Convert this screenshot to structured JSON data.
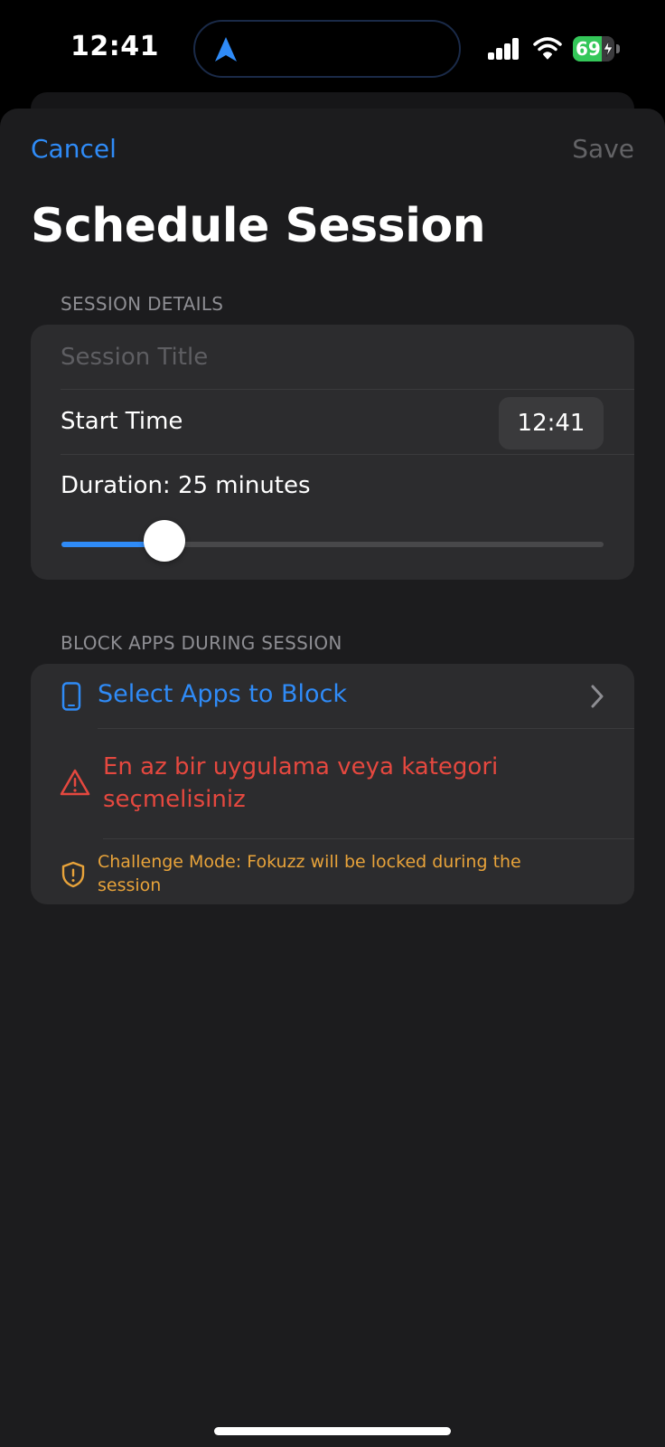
{
  "status_bar": {
    "time": "12:41",
    "battery_percent": "69",
    "battery_level": 0.69,
    "icons": [
      "navigation-arrow-icon",
      "cellular-signal-icon",
      "wifi-icon",
      "battery-charging-icon"
    ]
  },
  "nav": {
    "cancel_label": "Cancel",
    "save_label": "Save"
  },
  "title": "Schedule Session",
  "session_details": {
    "header": "SESSION DETAILS",
    "title_placeholder": "Session Title",
    "title_value": "",
    "start_time_label": "Start Time",
    "start_time_value": "12:41",
    "duration_label": "Duration: 25 minutes",
    "duration_slider_fraction": 0.19
  },
  "block_apps": {
    "header": "BLOCK APPS DURING SESSION",
    "select_label": "Select Apps to Block",
    "warning_text": "En az bir uygulama veya kategori seçmelisiniz",
    "challenge_text": "Challenge Mode: Fokuzz will be locked during the session"
  },
  "colors": {
    "accent": "#2f8bf7",
    "warning": "#e5483f",
    "challenge": "#e8a33a",
    "battery": "#34c759",
    "background": "#1c1c1e",
    "card": "#2c2c2e"
  }
}
